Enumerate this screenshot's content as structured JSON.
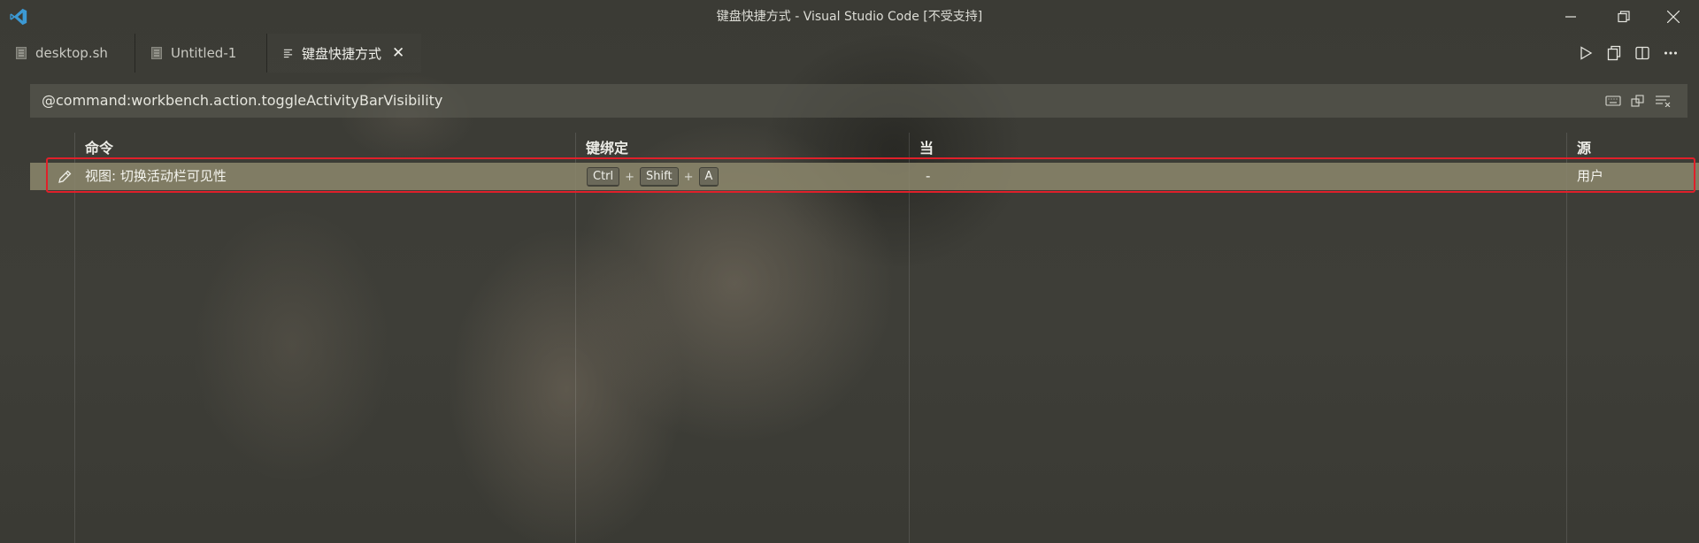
{
  "window": {
    "title": "键盘快捷方式 - Visual Studio Code [不受支持]",
    "accent": "#3c99d4"
  },
  "tabs": [
    {
      "label": "desktop.sh",
      "icon": "file-icon",
      "active": false
    },
    {
      "label": "Untitled-1",
      "icon": "file-icon",
      "active": false
    },
    {
      "label": "键盘快捷方式",
      "icon": "keyboard-shortcuts-icon",
      "active": true,
      "close": "✕"
    }
  ],
  "search": {
    "value": "@command:workbench.action.toggleActivityBarVisibility"
  },
  "table": {
    "headers": {
      "command": "命令",
      "keybinding": "键绑定",
      "when": "当",
      "source": "源"
    },
    "rows": [
      {
        "command": "视图: 切换活动栏可见性",
        "keys": [
          "Ctrl",
          "Shift",
          "A"
        ],
        "plus": "+",
        "when": "-",
        "source": "用户"
      }
    ]
  },
  "colors": {
    "selected_row": "#8c876c",
    "highlight_border": "#e0202a"
  }
}
